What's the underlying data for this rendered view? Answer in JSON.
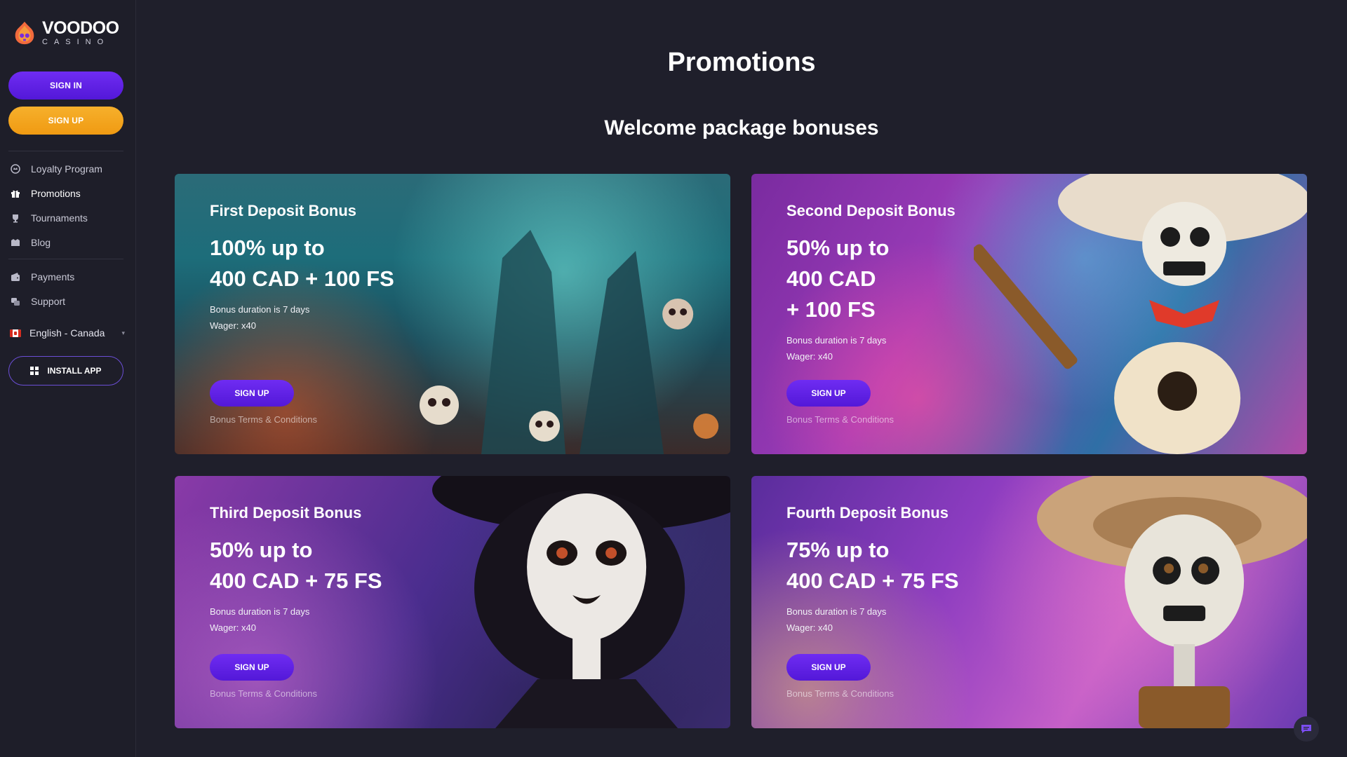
{
  "brand": {
    "name": "VOODOO",
    "sub": "CASINO"
  },
  "sidebar": {
    "signin_label": "SIGN IN",
    "signup_label": "SIGN UP",
    "nav_primary": [
      {
        "label": "Loyalty Program",
        "icon": "crown-icon"
      },
      {
        "label": "Promotions",
        "icon": "gift-icon"
      },
      {
        "label": "Tournaments",
        "icon": "trophy-icon"
      },
      {
        "label": "Blog",
        "icon": "blog-icon"
      }
    ],
    "nav_secondary": [
      {
        "label": "Payments",
        "icon": "wallet-icon"
      },
      {
        "label": "Support",
        "icon": "support-icon"
      }
    ],
    "language": "English - Canada",
    "install_label": "INSTALL APP"
  },
  "main": {
    "title": "Promotions",
    "section_title": "Welcome package bonuses",
    "cards": [
      {
        "title": "First Deposit Bonus",
        "amount_lines": [
          "100% up to",
          "400 CAD + 100 FS"
        ],
        "duration": "Bonus duration is 7 days",
        "wager": "Wager: x40",
        "button": "SIGN UP",
        "terms": "Bonus Terms & Conditions"
      },
      {
        "title": "Second Deposit Bonus",
        "amount_lines": [
          "50% up to",
          "400 CAD",
          "+ 100 FS"
        ],
        "duration": "Bonus duration is 7 days",
        "wager": "Wager: x40",
        "button": "SIGN UP",
        "terms": "Bonus Terms & Conditions"
      },
      {
        "title": "Third Deposit Bonus",
        "amount_lines": [
          "50% up to",
          "400 CAD + 75 FS"
        ],
        "duration": "Bonus duration is 7 days",
        "wager": "Wager: x40",
        "button": "SIGN UP",
        "terms": "Bonus Terms & Conditions"
      },
      {
        "title": "Fourth Deposit Bonus",
        "amount_lines": [
          "75% up to",
          "400 CAD + 75 FS"
        ],
        "duration": "Bonus duration is 7 days",
        "wager": "Wager: x40",
        "button": "SIGN UP",
        "terms": "Bonus Terms & Conditions"
      }
    ]
  },
  "colors": {
    "background": "#1f1f2b",
    "primary_button": "#5f22e6",
    "signup_button": "#f3a21d"
  }
}
